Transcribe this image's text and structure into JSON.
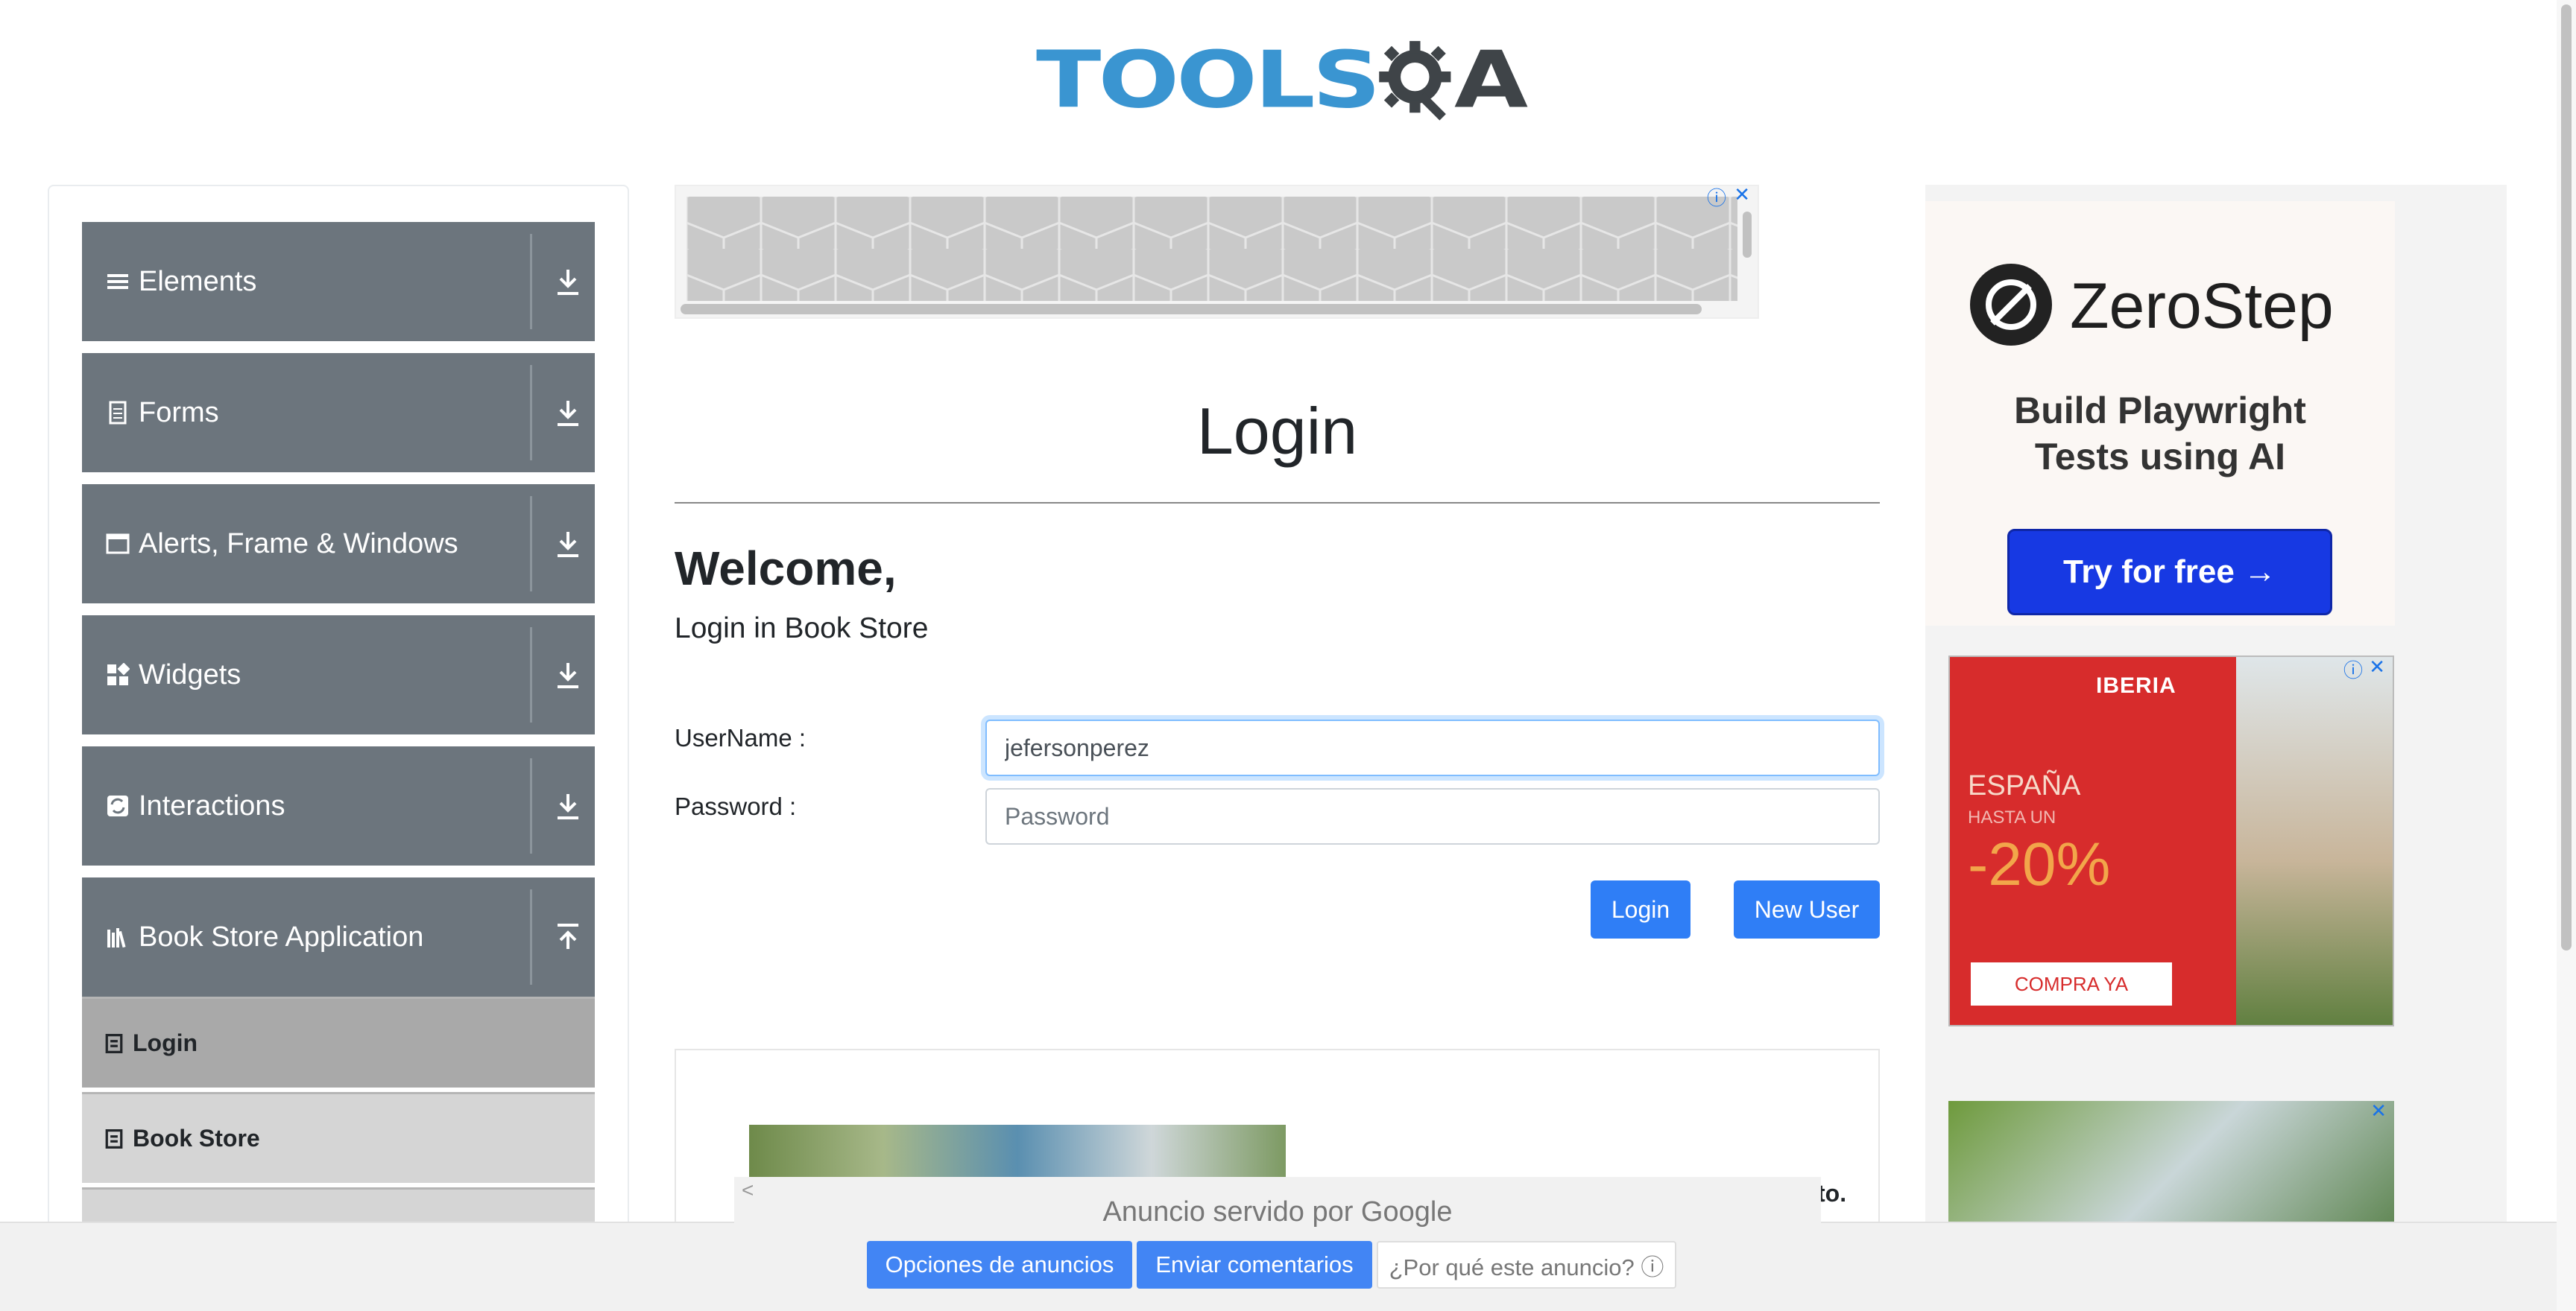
{
  "header": {
    "logo_text_tools": "TOOLS",
    "logo_text_qa": "A"
  },
  "sidebar": {
    "groups": [
      {
        "label": "Elements",
        "icon": "hamburger-icon",
        "arrow": "download-arrow-icon"
      },
      {
        "label": "Forms",
        "icon": "document-icon",
        "arrow": "download-arrow-icon"
      },
      {
        "label": "Alerts, Frame & Windows",
        "icon": "window-icon",
        "arrow": "download-arrow-icon"
      },
      {
        "label": "Widgets",
        "icon": "widgets-icon",
        "arrow": "download-arrow-icon"
      },
      {
        "label": "Interactions",
        "icon": "interactions-icon",
        "arrow": "download-arrow-icon"
      },
      {
        "label": "Book Store Application",
        "icon": "books-icon",
        "arrow": "upload-arrow-icon"
      }
    ],
    "book_store_items": [
      {
        "label": "Login",
        "active": true
      },
      {
        "label": "Book Store",
        "active": false
      }
    ]
  },
  "main": {
    "title": "Login",
    "welcome": "Welcome,",
    "subtitle": "Login in Book Store",
    "username_label": "UserName :",
    "username_value": "jefersonperez",
    "password_label": "Password :",
    "password_placeholder": "Password",
    "login_button": "Login",
    "new_user_button": "New User",
    "lower_text": "to."
  },
  "ads": {
    "zerostep": {
      "name": "ZeroStep",
      "tagline_1": "Build Playwright",
      "tagline_2": "Tests using AI",
      "cta": "Try for free →"
    },
    "iberia": {
      "brand": "IBERIA",
      "line1": "ESPAÑA",
      "line2": "HASTA UN",
      "discount": "-20%",
      "cta": "COMPRA YA"
    },
    "adchoices_symbol": "ⓘ",
    "close_symbol": "✕"
  },
  "google_bar": {
    "served_by": "Anuncio servido por Google",
    "options": "Opciones de anuncios",
    "feedback": "Enviar comentarios",
    "why": "¿Por qué este anuncio? ⓘ",
    "back": "<"
  },
  "colors": {
    "sidebar_group": "#6c757d",
    "primary_button": "#2f7ef6",
    "logo_blue": "#3a95d1"
  }
}
